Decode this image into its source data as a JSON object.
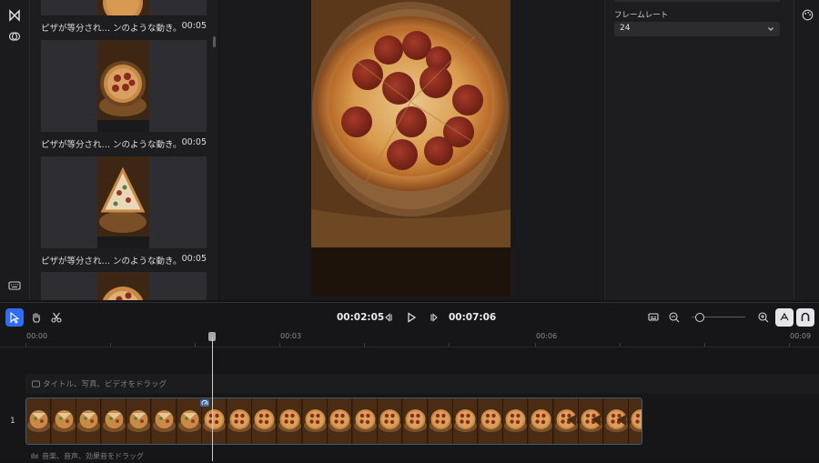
{
  "media_panel": {
    "items": [
      {
        "caption": "ピザが等分され… ンのような動き。",
        "duration": "00:05",
        "variant": "full"
      },
      {
        "caption": "ピザが等分され… ンのような動き。",
        "duration": "00:05",
        "variant": "pepperoni"
      },
      {
        "caption": "ピザが等分され… ンのような動き。",
        "duration": "00:05",
        "variant": "slice"
      },
      {
        "caption": "",
        "duration": "",
        "variant": "partial"
      }
    ]
  },
  "properties": {
    "frame_rate_label": "フレームレート",
    "frame_rate_value": "24"
  },
  "timeline": {
    "current_time": "00:02:05",
    "total_time": "00:07:06",
    "ruler": [
      "00:00",
      "00:03",
      "00:06",
      "00:09"
    ],
    "text_track_hint": "タイトル、写真、ビデオをドラッグ",
    "track_number": "1",
    "audio_track_hint": "音楽、音声、効果音をドラッグ",
    "zoom_level": 0.08
  },
  "colors": {
    "accent": "#2f6cf6",
    "clip_border": "#3b5a78",
    "pizza_crust": "#c98a45",
    "pepperoni": "#8e2a1d",
    "board": "#7a4f27"
  }
}
